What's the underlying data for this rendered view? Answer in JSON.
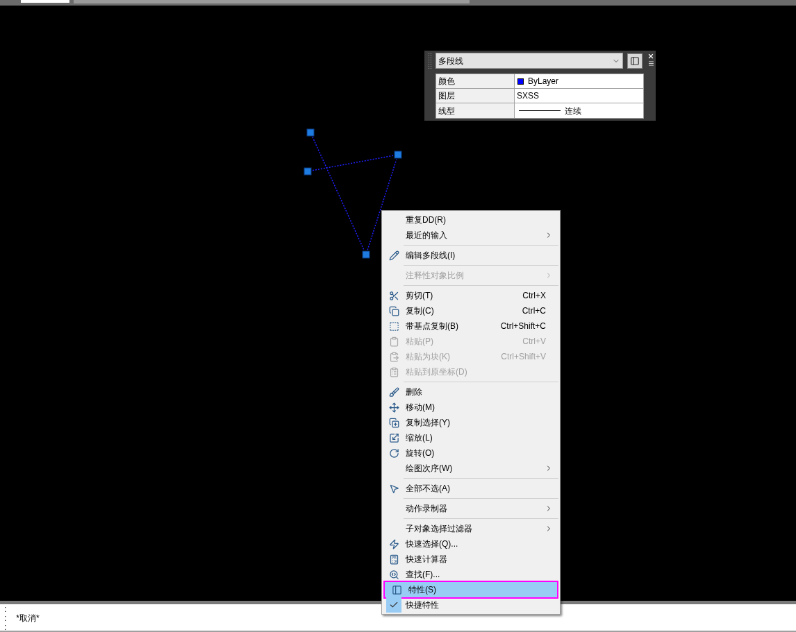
{
  "quick_properties": {
    "object_type": "多段线",
    "rows": [
      {
        "label": "颜色",
        "value": "ByLayer",
        "color": "#0000ff",
        "kind": "color"
      },
      {
        "label": "图层",
        "value": "SXSS",
        "kind": "text"
      },
      {
        "label": "线型",
        "value": "连续",
        "kind": "linetype"
      }
    ]
  },
  "context_menu": {
    "items": [
      {
        "kind": "item",
        "label": "重复DD(R)",
        "disabled": false,
        "submenu": false,
        "selected": false
      },
      {
        "kind": "item",
        "label": "最近的输入",
        "disabled": false,
        "submenu": true,
        "selected": false
      },
      {
        "kind": "separator"
      },
      {
        "kind": "item",
        "label": "编辑多段线(I)",
        "disabled": false,
        "submenu": false,
        "selected": false
      },
      {
        "kind": "separator"
      },
      {
        "kind": "item",
        "label": "注释性对象比例",
        "disabled": true,
        "submenu": true,
        "selected": false
      },
      {
        "kind": "separator"
      },
      {
        "kind": "item",
        "label": "剪切(T)",
        "shortcut": "Ctrl+X",
        "disabled": false,
        "submenu": false,
        "selected": false
      },
      {
        "kind": "item",
        "label": "复制(C)",
        "shortcut": "Ctrl+C",
        "disabled": false,
        "submenu": false,
        "selected": false
      },
      {
        "kind": "item",
        "label": "带基点复制(B)",
        "shortcut": "Ctrl+Shift+C",
        "disabled": false,
        "submenu": false,
        "selected": false
      },
      {
        "kind": "item",
        "label": "粘贴(P)",
        "shortcut": "Ctrl+V",
        "disabled": true,
        "submenu": false,
        "selected": false
      },
      {
        "kind": "item",
        "label": "粘贴为块(K)",
        "shortcut": "Ctrl+Shift+V",
        "disabled": true,
        "submenu": false,
        "selected": false
      },
      {
        "kind": "item",
        "label": "粘贴到原坐标(D)",
        "disabled": true,
        "submenu": false,
        "selected": false
      },
      {
        "kind": "separator"
      },
      {
        "kind": "item",
        "label": "删除",
        "disabled": false,
        "submenu": false,
        "selected": false
      },
      {
        "kind": "item",
        "label": "移动(M)",
        "disabled": false,
        "submenu": false,
        "selected": false
      },
      {
        "kind": "item",
        "label": "复制选择(Y)",
        "disabled": false,
        "submenu": false,
        "selected": false
      },
      {
        "kind": "item",
        "label": "缩放(L)",
        "disabled": false,
        "submenu": false,
        "selected": false
      },
      {
        "kind": "item",
        "label": "旋转(O)",
        "disabled": false,
        "submenu": false,
        "selected": false
      },
      {
        "kind": "item",
        "label": "绘图次序(W)",
        "disabled": false,
        "submenu": true,
        "selected": false
      },
      {
        "kind": "separator"
      },
      {
        "kind": "item",
        "label": "全部不选(A)",
        "disabled": false,
        "submenu": false,
        "selected": false
      },
      {
        "kind": "separator"
      },
      {
        "kind": "item",
        "label": "动作录制器",
        "disabled": false,
        "submenu": true,
        "selected": false
      },
      {
        "kind": "separator"
      },
      {
        "kind": "item",
        "label": "子对象选择过滤器",
        "disabled": false,
        "submenu": true,
        "selected": false
      },
      {
        "kind": "item",
        "label": "快速选择(Q)...",
        "disabled": false,
        "submenu": false,
        "selected": false
      },
      {
        "kind": "item",
        "label": "快速计算器",
        "disabled": false,
        "submenu": false,
        "selected": false
      },
      {
        "kind": "item",
        "label": "查找(F)...",
        "disabled": false,
        "submenu": false,
        "selected": false
      },
      {
        "kind": "item",
        "label": "特性(S)",
        "disabled": false,
        "submenu": false,
        "selected": true
      },
      {
        "kind": "check",
        "label": "快捷特性",
        "checked": true,
        "disabled": false,
        "submenu": false,
        "selected": false
      }
    ]
  },
  "command_line": {
    "lines": [
      {
        "prompt": ":"
      },
      {
        "prompt": ":",
        "text": "*取消*"
      },
      {
        "prompt": ":"
      }
    ]
  }
}
